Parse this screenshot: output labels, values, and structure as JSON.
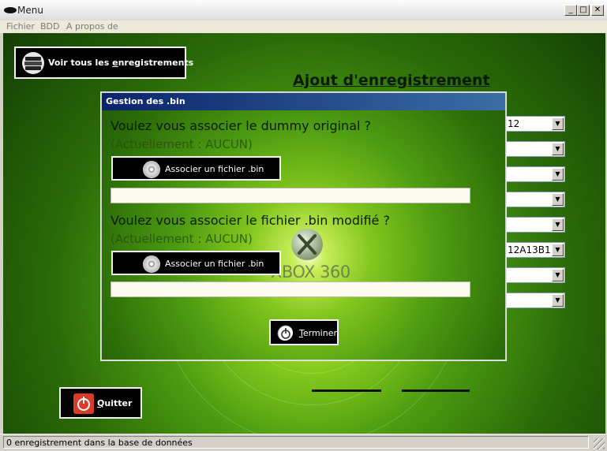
{
  "window": {
    "title": "Menu",
    "controls": {
      "minimize": "_",
      "maximize": "□",
      "close": "✕"
    }
  },
  "menubar": {
    "items": [
      "Fichier",
      "BDD",
      "A propos de"
    ]
  },
  "main": {
    "view_all_prefix": "Voir tous les ",
    "view_all_underlined": "e",
    "view_all_suffix": "nregistrements",
    "heading": "Ajout d'enregistrement",
    "combos": [
      "12",
      "",
      "",
      "",
      "",
      "12A13B1",
      "",
      ""
    ],
    "quit_underlined": "Q",
    "quit_suffix": "uitter",
    "icons": {
      "view_all": "books-icon",
      "quit": "power-icon",
      "combo_arrow": "chevron-down-icon"
    },
    "colors": {
      "quit_icon": "#d93a2a",
      "background_accent": "#4a9a10"
    }
  },
  "dialog": {
    "title": "Gestion des .bin",
    "question_dummy": "Voulez vous associer le dummy original ?",
    "current_dummy": "(Actuellement :  AUCUN)",
    "question_modified": "Voulez vous associer le fichier .bin modifié ?",
    "current_modified": "(Actuellement :  AUCUN)",
    "associate_label": "Associer un fichier .bin",
    "field_dummy_value": "",
    "field_modified_value": "",
    "finish_underlined": "T",
    "finish_suffix": "erminer",
    "watermark": "XBOX 360",
    "icons": {
      "associate": "disc-icon",
      "finish": "power-icon"
    }
  },
  "statusbar": {
    "text": "0 enregistrement dans la base de données"
  }
}
